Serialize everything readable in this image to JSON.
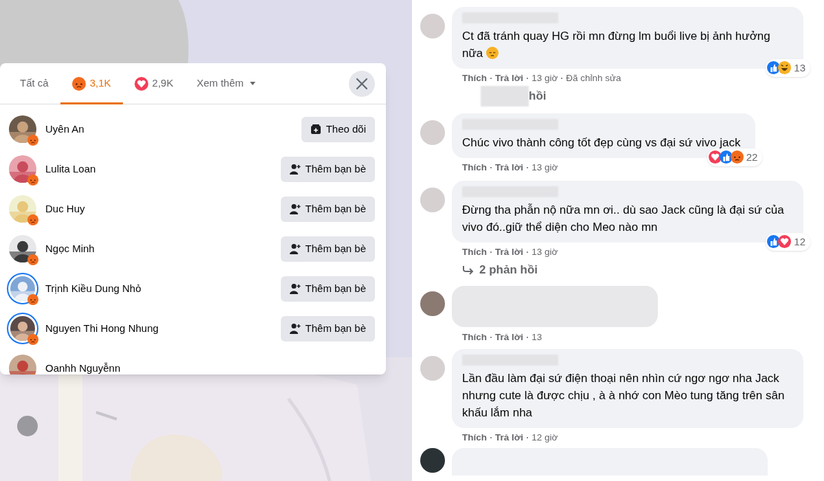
{
  "reactions_dialog": {
    "tabs": [
      {
        "kind": "all",
        "label": "Tất cả",
        "selected": false
      },
      {
        "kind": "angry",
        "label": "3,1K",
        "selected": true
      },
      {
        "kind": "love",
        "label": "2,9K",
        "selected": false
      },
      {
        "kind": "more",
        "label": "Xem thêm",
        "selected": false
      }
    ],
    "people": [
      {
        "name": "Uyên An",
        "story_ring": false,
        "action": {
          "kind": "follow",
          "label": "Theo dõi"
        }
      },
      {
        "name": "Lulita Loan",
        "story_ring": false,
        "action": {
          "kind": "add_friend",
          "label": "Thêm bạn bè"
        }
      },
      {
        "name": "Duc Huy",
        "story_ring": false,
        "action": {
          "kind": "add_friend",
          "label": "Thêm bạn bè"
        }
      },
      {
        "name": "Ngọc Minh",
        "story_ring": false,
        "action": {
          "kind": "add_friend",
          "label": "Thêm bạn bè"
        }
      },
      {
        "name": "Trịnh Kiều Dung Nhỏ",
        "story_ring": true,
        "action": {
          "kind": "add_friend",
          "label": "Thêm bạn bè"
        }
      },
      {
        "name": "Nguyen Thi Hong Nhung",
        "story_ring": true,
        "action": {
          "kind": "add_friend",
          "label": "Thêm bạn bè"
        }
      },
      {
        "name": "Oanhh Nguyễnn",
        "story_ring": false
      }
    ]
  },
  "comments": [
    {
      "kind": "comment",
      "text": "Ct đã tránh quay HG rồi mn đừng lm buổi live bị ảnh hưởng nữa",
      "emoji": {
        "kind": "sad"
      },
      "reactions": [
        {
          "kind": "like"
        },
        {
          "kind": "haha"
        }
      ],
      "reaction_count": "13",
      "meta": [
        "Thích",
        "Trả lời",
        "13 giờ",
        "Đã chỉnh sửa"
      ]
    },
    {
      "kind": "replies",
      "label": "hồi",
      "blurred": true
    },
    {
      "kind": "comment",
      "text": "Chúc vivo thành công tốt đẹp cùng vs đại sứ vivo jack",
      "reactions": [
        {
          "kind": "love"
        },
        {
          "kind": "like"
        },
        {
          "kind": "angry"
        }
      ],
      "reaction_count": "22",
      "meta": [
        "Thích",
        "Trả lời",
        "13 giờ"
      ]
    },
    {
      "kind": "comment",
      "text": "Đừng tha phẫn nộ nữa mn ơi.. dù sao Jack cũng là đại sứ của vivo đó..giữ thể diện cho Meo nào mn",
      "reactions": [
        {
          "kind": "like"
        },
        {
          "kind": "love"
        }
      ],
      "reaction_count": "12",
      "meta": [
        "Thích",
        "Trả lời",
        "13 giờ"
      ]
    },
    {
      "kind": "replies",
      "label": "2 phản hồi",
      "blurred": false
    },
    {
      "kind": "blurred_comment",
      "meta": [
        "Thích",
        "Trả lời",
        "13"
      ]
    },
    {
      "kind": "comment",
      "text": "Lần đầu làm đại sứ điện thoại nên nhìn cứ ngơ ngơ nha Jack nhưng cute là được chịu , à à nhớ con Mèo tung tăng trên sân khấu lắm nha",
      "meta": [
        "Thích",
        "Trả lời",
        "12 giờ"
      ]
    },
    {
      "kind": "hidden_comment"
    }
  ]
}
